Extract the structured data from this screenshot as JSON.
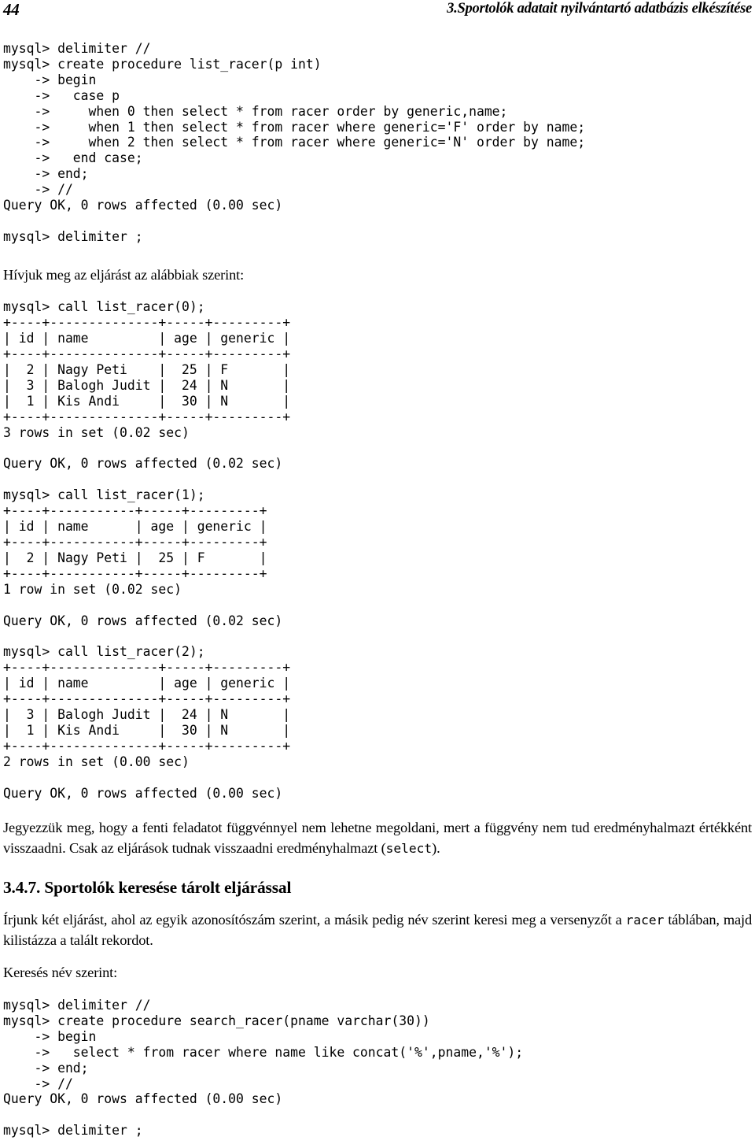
{
  "header": {
    "folio": "44",
    "title": "3.Sportolók adatait nyilvántartó adatbázis elkészítése"
  },
  "blocks": {
    "code_create_list_racer": "mysql> delimiter //\nmysql> create procedure list_racer(p int)\n    -> begin\n    ->   case p\n    ->     when 0 then select * from racer order by generic,name;\n    ->     when 1 then select * from racer where generic='F' order by name;\n    ->     when 2 then select * from racer where generic='N' order by name;\n    ->   end case;\n    -> end;\n    -> //\nQuery OK, 0 rows affected (0.00 sec)\n\nmysql> delimiter ;",
    "intro_call": "Hívjuk meg az eljárást az alábbiak szerint:",
    "code_call_0": "mysql> call list_racer(0);\n+----+--------------+-----+---------+\n| id | name         | age | generic |\n+----+--------------+-----+---------+\n|  2 | Nagy Peti    |  25 | F       |\n|  3 | Balogh Judit |  24 | N       |\n|  1 | Kis Andi     |  30 | N       |\n+----+--------------+-----+---------+\n3 rows in set (0.02 sec)\n\nQuery OK, 0 rows affected (0.02 sec)",
    "code_call_1": "mysql> call list_racer(1);\n+----+-----------+-----+---------+\n| id | name      | age | generic |\n+----+-----------+-----+---------+\n|  2 | Nagy Peti |  25 | F       |\n+----+-----------+-----+---------+\n1 row in set (0.02 sec)\n\nQuery OK, 0 rows affected (0.02 sec)",
    "code_call_2": "mysql> call list_racer(2);\n+----+--------------+-----+---------+\n| id | name         | age | generic |\n+----+--------------+-----+---------+\n|  3 | Balogh Judit |  24 | N       |\n|  1 | Kis Andi     |  30 | N       |\n+----+--------------+-----+---------+\n2 rows in set (0.00 sec)\n\nQuery OK, 0 rows affected (0.00 sec)",
    "note_part1": "Jegyezzük meg, hogy a fenti feladatot függvénnyel nem lehetne megoldani, mert a függvény nem tud eredményhalmazt értékként visszaadni. Csak az eljárások tudnak visszaadni eredményhalmazt (",
    "note_code": "select",
    "note_part2": ").",
    "section_heading": "3.4.7. Sportolók keresése tárolt eljárással",
    "task_part1": "Írjunk két eljárást, ahol az egyik azonosítószám szerint, a másik pedig név szerint keresi meg a versenyzőt a ",
    "task_code": "racer",
    "task_part2": " táblában, majd kilistázza a talált rekordot.",
    "search_label": "Keresés név szerint:",
    "code_search_racer": "mysql> delimiter //\nmysql> create procedure search_racer(pname varchar(30))\n    -> begin\n    ->   select * from racer where name like concat('%',pname,'%');\n    -> end;\n    -> //\nQuery OK, 0 rows affected (0.00 sec)\n\nmysql> delimiter ;"
  },
  "tables": {
    "columns": [
      "id",
      "name",
      "age",
      "generic"
    ],
    "call_0": {
      "statement": "call list_racer(0);",
      "rows": [
        [
          "2",
          "Nagy Peti",
          "25",
          "F"
        ],
        [
          "3",
          "Balogh Judit",
          "24",
          "N"
        ],
        [
          "1",
          "Kis Andi",
          "30",
          "N"
        ]
      ],
      "row_count_text": "3 rows in set (0.02 sec)",
      "query_ok_text": "Query OK, 0 rows affected (0.02 sec)"
    },
    "call_1": {
      "statement": "call list_racer(1);",
      "rows": [
        [
          "2",
          "Nagy Peti",
          "25",
          "F"
        ]
      ],
      "row_count_text": "1 row in set (0.02 sec)",
      "query_ok_text": "Query OK, 0 rows affected (0.02 sec)"
    },
    "call_2": {
      "statement": "call list_racer(2);",
      "rows": [
        [
          "3",
          "Balogh Judit",
          "24",
          "N"
        ],
        [
          "1",
          "Kis Andi",
          "30",
          "N"
        ]
      ],
      "row_count_text": "2 rows in set (0.00 sec)",
      "query_ok_text": "Query OK, 0 rows affected (0.00 sec)"
    }
  },
  "colors": {
    "text": "#000000",
    "background": "#ffffff"
  }
}
